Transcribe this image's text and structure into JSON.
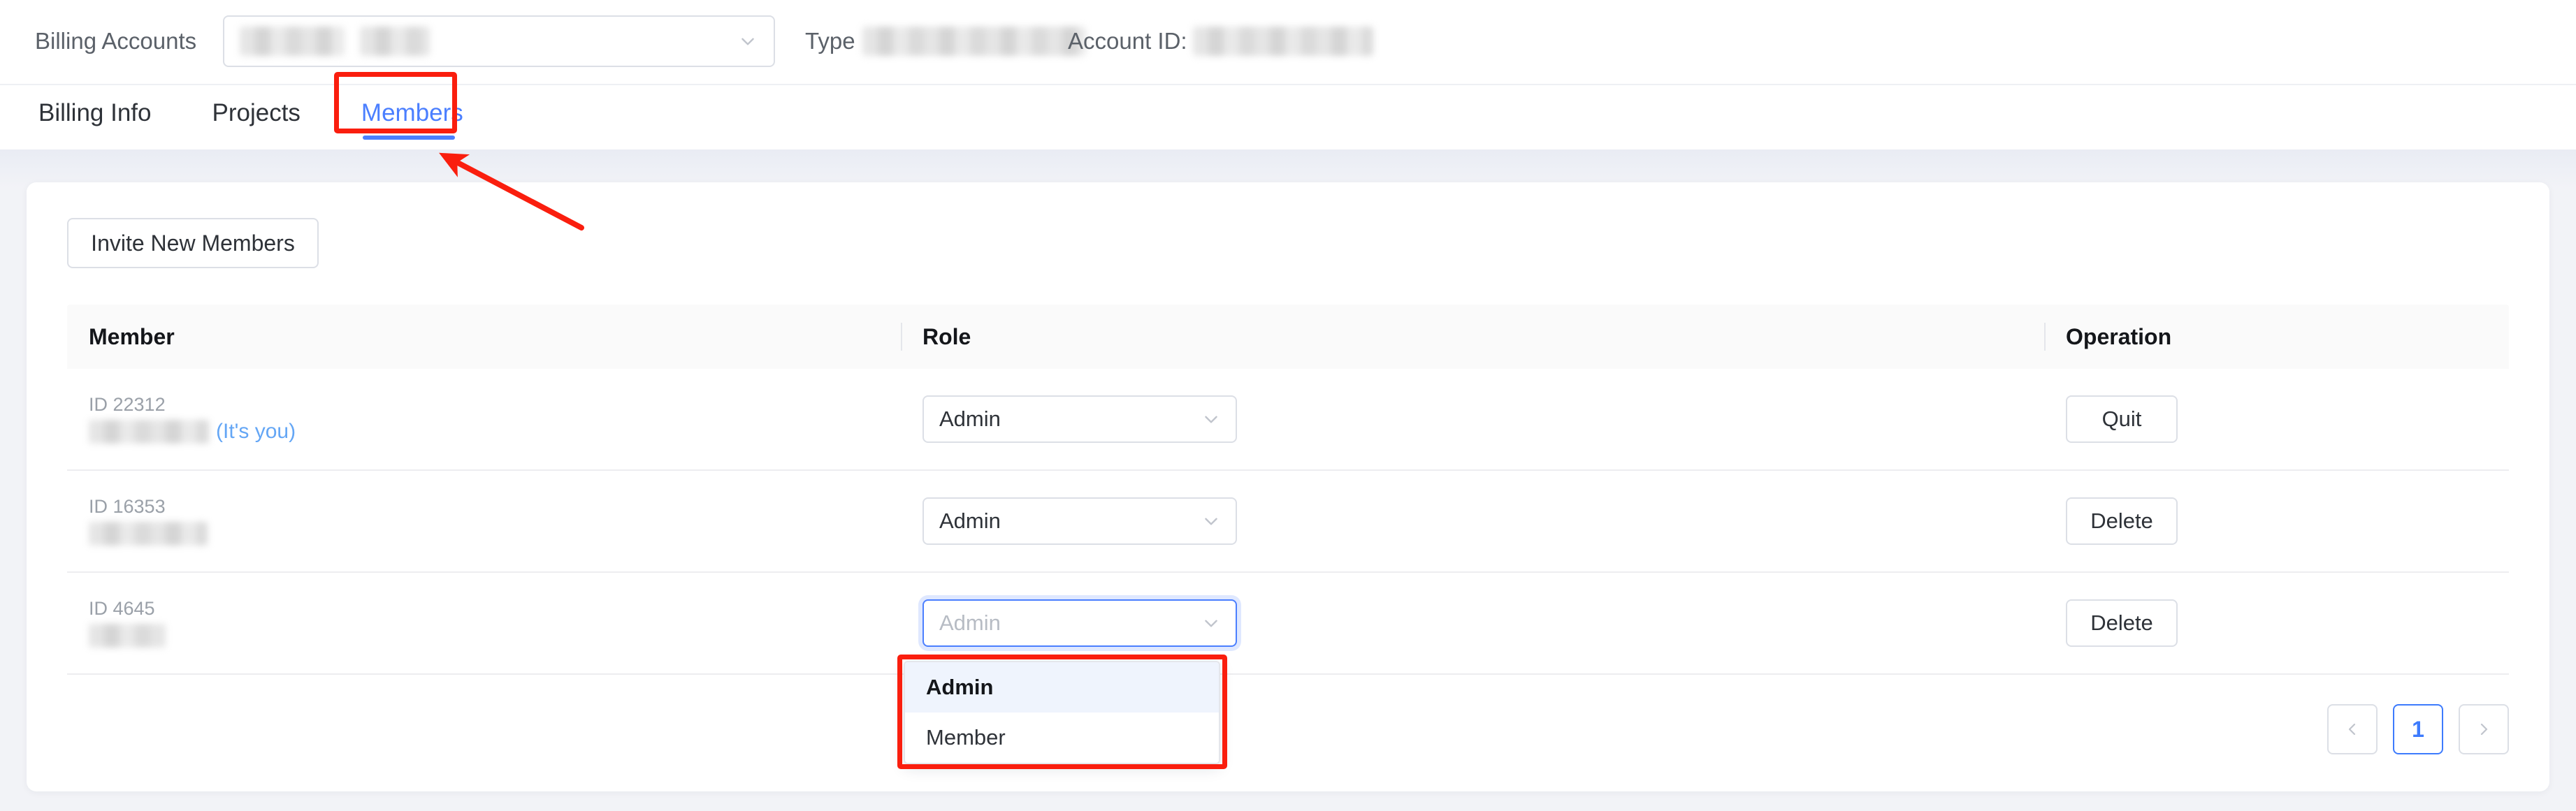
{
  "topbar": {
    "billing_accounts_label": "Billing Accounts",
    "account_select_value": "",
    "type_label": "Type",
    "type_value": "",
    "account_id_label": "Account ID:",
    "account_id_value": ""
  },
  "tabs": [
    {
      "label": "Billing Info",
      "active": false
    },
    {
      "label": "Projects",
      "active": false
    },
    {
      "label": "Members",
      "active": true
    }
  ],
  "toolbar": {
    "invite_label": "Invite New Members"
  },
  "table": {
    "headers": {
      "member": "Member",
      "role": "Role",
      "operation": "Operation"
    },
    "rows": [
      {
        "id_label": "ID 22312",
        "name": "",
        "its_you": "(It's you)",
        "role": "Admin",
        "operation": "Quit",
        "role_focused": false
      },
      {
        "id_label": "ID 16353",
        "name": "",
        "its_you": "",
        "role": "Admin",
        "operation": "Delete",
        "role_focused": false
      },
      {
        "id_label": "ID 4645",
        "name": "",
        "its_you": "",
        "role": "Admin",
        "operation": "Delete",
        "role_focused": true
      }
    ]
  },
  "role_dropdown": {
    "open": true,
    "options": [
      {
        "label": "Admin",
        "selected": true
      },
      {
        "label": "Member",
        "selected": false
      }
    ]
  },
  "pagination": {
    "prev": "‹",
    "next": "›",
    "pages": [
      "1"
    ],
    "current": "1"
  },
  "colors": {
    "accent_blue": "#4b7fff",
    "link_blue": "#64a6f5",
    "annotation_red": "#fa1e0e",
    "page_bg": "#f2f3f7",
    "border": "#dcdfe6"
  },
  "annotations": {
    "members_tab_highlight": "red-rectangle",
    "members_tab_arrow": "red-arrow",
    "role_dropdown_highlight": "red-rectangle"
  }
}
